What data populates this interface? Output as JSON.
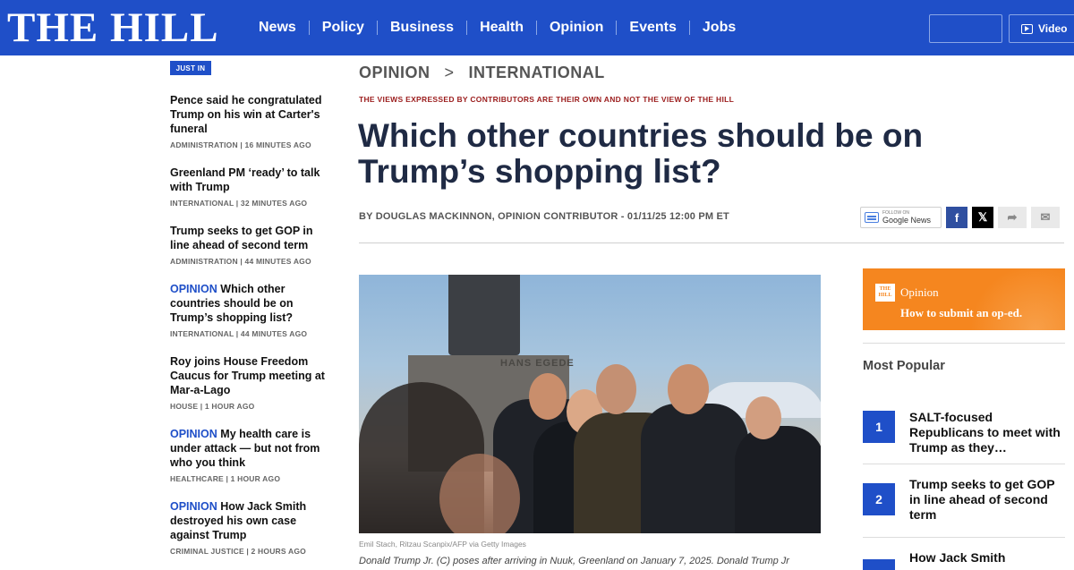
{
  "header": {
    "logo": "THE HILL",
    "nav": [
      "News",
      "Policy",
      "Business",
      "Health",
      "Opinion",
      "Events",
      "Jobs"
    ],
    "video_label": "Video",
    "brand_color": "#1f4fc8"
  },
  "just_in": {
    "badge": "JUST IN",
    "items": [
      {
        "prefix": "",
        "title": "Pence said he congratulated Trump on his win at Carter's funeral",
        "meta": "ADMINISTRATION | 16 MINUTES AGO"
      },
      {
        "prefix": "",
        "title": "Greenland PM ‘ready’ to talk with Trump",
        "meta": "INTERNATIONAL | 32 MINUTES AGO"
      },
      {
        "prefix": "",
        "title": "Trump seeks to get GOP in line ahead of second term",
        "meta": "ADMINISTRATION | 44 MINUTES AGO"
      },
      {
        "prefix": "OPINION",
        "title": "Which other countries should be on Trump’s shopping list?",
        "meta": "INTERNATIONAL | 44 MINUTES AGO"
      },
      {
        "prefix": "",
        "title": "Roy joins House Freedom Caucus for Trump meeting at Mar-a-Lago",
        "meta": "HOUSE | 1 HOUR AGO"
      },
      {
        "prefix": "OPINION",
        "title": "My health care is under attack — but not from who you think",
        "meta": "HEALTHCARE | 1 HOUR AGO"
      },
      {
        "prefix": "OPINION",
        "title": "How Jack Smith destroyed his own case against Trump",
        "meta": "CRIMINAL JUSTICE | 2 HOURS AGO"
      }
    ]
  },
  "article": {
    "breadcrumb_section": "OPINION",
    "breadcrumb_sep": ">",
    "breadcrumb_sub": "INTERNATIONAL",
    "disclaimer": "THE VIEWS EXPRESSED BY CONTRIBUTORS ARE THEIR OWN AND NOT THE VIEW OF THE HILL",
    "headline": "Which other countries should be on Trump’s shopping list?",
    "byline": "BY DOUGLAS MACKINNON, OPINION CONTRIBUTOR - 01/11/25 12:00 PM ET",
    "google_news_small": "FOLLOW ON",
    "google_news": "Google News",
    "image_text": "HANS EGEDE",
    "photo_credit": "Emil Stach, Ritzau Scanpix/AFP via Getty Images",
    "caption": "Donald Trump Jr. (C) poses after arriving in Nuuk, Greenland on January 7, 2025. Donald Trump Jr"
  },
  "rail": {
    "oped_logo": "THE HILL",
    "oped_title": "Opinion",
    "oped_link": "How to submit an op-ed.",
    "oped_color": "#f5861f",
    "most_popular_title": "Most Popular",
    "most_popular": [
      {
        "rank": "1",
        "title": "SALT-focused Republicans to meet with Trump as they…"
      },
      {
        "rank": "2",
        "title": "Trump seeks to get GOP in line ahead of second term"
      },
      {
        "rank": "3",
        "title": "How Jack Smith"
      }
    ]
  }
}
